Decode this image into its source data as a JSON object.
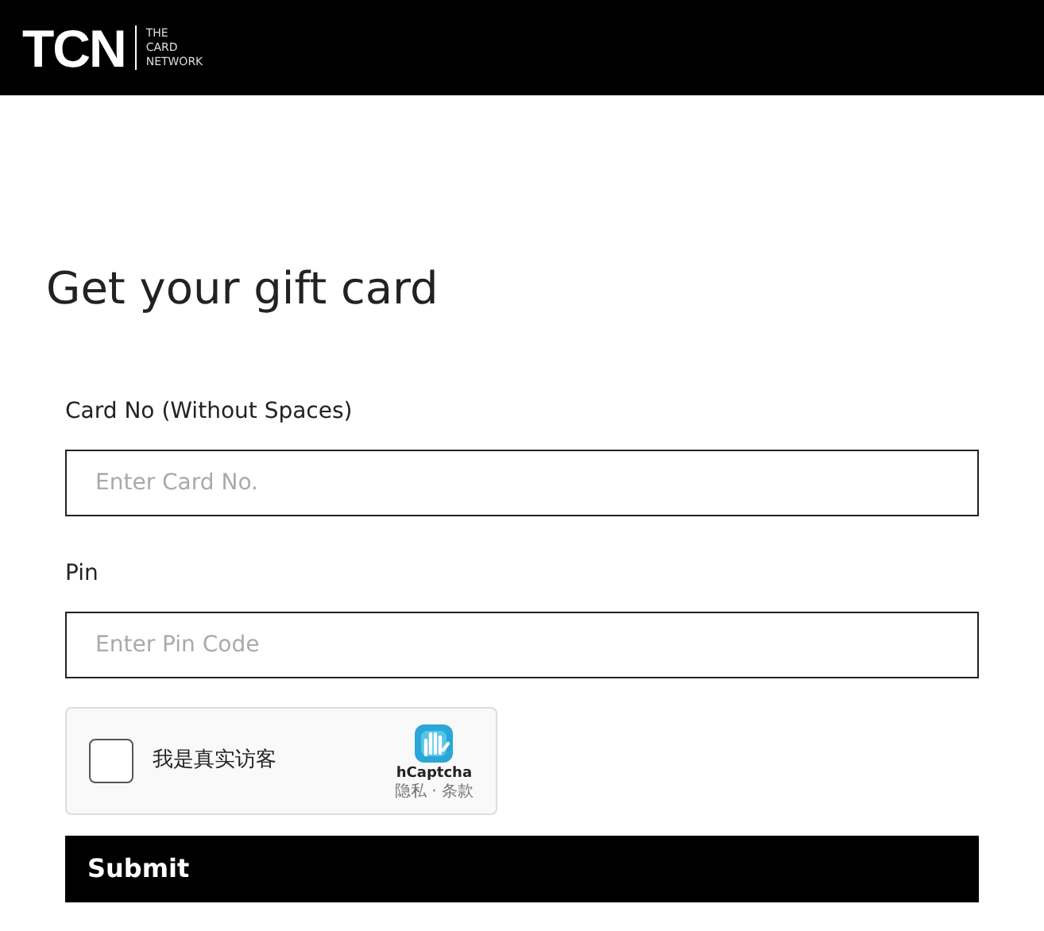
{
  "header": {
    "logo": "TCN",
    "tagline": [
      "THE",
      "CARD",
      "NETWORK"
    ]
  },
  "title": "Get your gift card",
  "fields": [
    {
      "label": "Card No (Without Spaces)",
      "placeholder": "Enter Card No."
    },
    {
      "label": "Pin",
      "placeholder": "Enter Pin Code"
    }
  ],
  "captcha": {
    "checked": false,
    "label": "我是真实访客",
    "brand": "hCaptcha",
    "links": "隐私 · 条款"
  },
  "submit": "Submit"
}
